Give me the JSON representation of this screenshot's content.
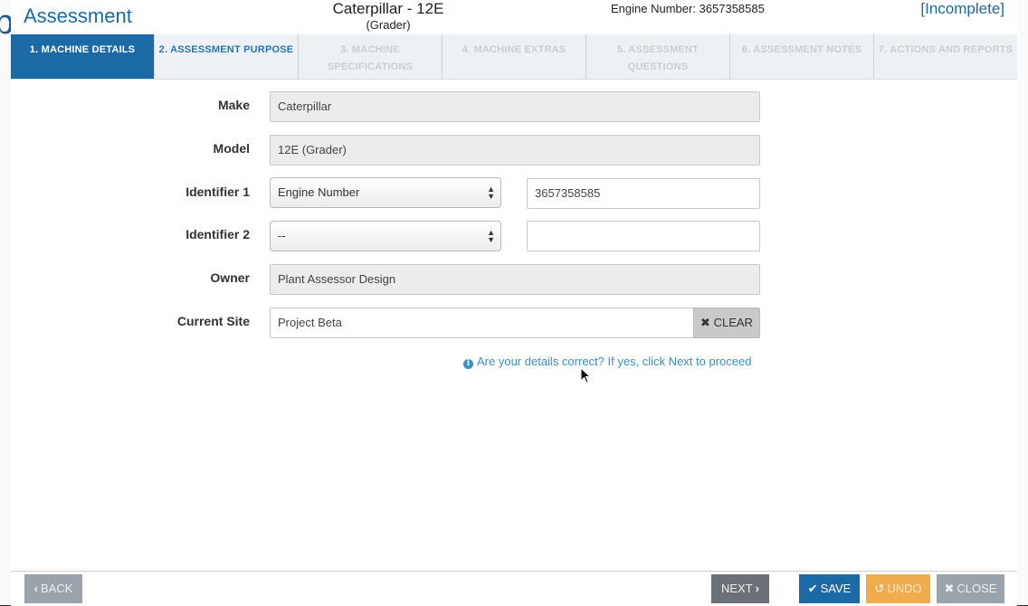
{
  "header": {
    "title": "Assessment",
    "machine_name": "Caterpillar - 12E",
    "machine_subtitle": "(Grader)",
    "engine_number": "Engine Number: 3657358585",
    "status": "[Incomplete]"
  },
  "tabs": [
    {
      "label": "1. Machine Details",
      "state": "active"
    },
    {
      "label": "2. Assessment Purpose",
      "state": "enabled"
    },
    {
      "label": "3. Machine Specifications",
      "state": "disabled"
    },
    {
      "label": "4. Machine Extras",
      "state": "disabled"
    },
    {
      "label": "5. Assessment Questions",
      "state": "disabled"
    },
    {
      "label": "6. Assessment Notes",
      "state": "disabled"
    },
    {
      "label": "7. Actions and Reports",
      "state": "disabled"
    }
  ],
  "form": {
    "make": {
      "label": "Make",
      "value": "Caterpillar"
    },
    "model": {
      "label": "Model",
      "value": "12E (Grader)"
    },
    "identifier1": {
      "label": "Identifier 1",
      "type": "Engine Number",
      "value": "3657358585"
    },
    "identifier2": {
      "label": "Identifier 2",
      "type": "--",
      "value": ""
    },
    "owner": {
      "label": "Owner",
      "value": "Plant Assessor Design"
    },
    "current_site": {
      "label": "Current Site",
      "value": "Project Beta",
      "clear_label": "CLEAR"
    },
    "hint": "Are your details correct? If yes, click Next to proceed"
  },
  "footer": {
    "back": "BACK",
    "next": "NEXT",
    "save": "SAVE",
    "undo": "UNDO",
    "close": "CLOSE"
  },
  "colors": {
    "primary": "#1b6aa5",
    "warning": "#f0ad4e",
    "muted": "#9aa3a9",
    "hint": "#3a8fcb"
  },
  "icons": {
    "back": "chevron-left-icon",
    "next": "chevron-right-icon",
    "save": "check-icon",
    "undo": "undo-icon",
    "close": "times-icon",
    "clear": "times-icon",
    "hint": "info-icon"
  }
}
